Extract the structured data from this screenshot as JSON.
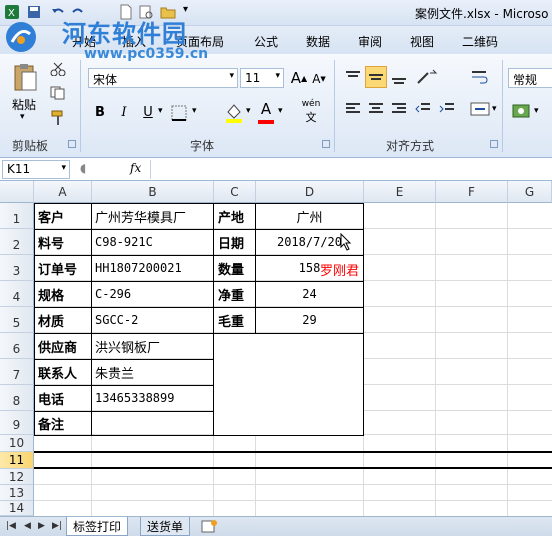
{
  "window": {
    "title": "案例文件.xlsx - Microso"
  },
  "watermark": {
    "name": "河东软件园",
    "url": "www.pc0359.cn"
  },
  "ribbon_tabs": [
    "开始",
    "插入",
    "页面布局",
    "公式",
    "数据",
    "审阅",
    "视图",
    "二维码"
  ],
  "clipboard": {
    "paste_label": "粘贴",
    "group_label": "剪贴板"
  },
  "font": {
    "family": "宋体",
    "size": "11",
    "grow_label": "A",
    "shrink_label": "A",
    "bold": "B",
    "italic": "I",
    "underline": "U",
    "font_color_letter": "A",
    "phonetic_label": "wén",
    "group_label": "字体",
    "color_accent": "#ff0000",
    "highlight_accent": "#ffff00"
  },
  "alignment": {
    "group_label": "对齐方式"
  },
  "number": {
    "format": "常规"
  },
  "formula_bar": {
    "name_box": "K11",
    "fx": "fx",
    "value": ""
  },
  "columns": [
    "A",
    "B",
    "C",
    "D",
    "E",
    "F",
    "G"
  ],
  "rows": [
    "1",
    "2",
    "3",
    "4",
    "5",
    "6",
    "7",
    "8",
    "9",
    "10",
    "11",
    "12",
    "13",
    "14"
  ],
  "selected_row": "11",
  "table": {
    "left_labels": [
      "客户",
      "料号",
      "订单号",
      "规格",
      "材质",
      "供应商",
      "联系人",
      "电话",
      "备注"
    ],
    "left_values": [
      "广州芳华模具厂",
      "C98-921C",
      "HH1807200021",
      "C-296",
      "SGCC-2",
      "洪兴钢板厂",
      "朱贵兰",
      "13465338899",
      ""
    ],
    "right_labels": [
      "产地",
      "日期",
      "数量",
      "净重",
      "毛重"
    ],
    "right_values": [
      "广州",
      "2018/7/20",
      "158",
      "24",
      "29"
    ],
    "annotation": "罗刚君",
    "annotation_color": "#ff0000"
  },
  "sheets": [
    {
      "name": "标签打印",
      "active": true
    },
    {
      "name": "送货单",
      "active": false
    }
  ]
}
